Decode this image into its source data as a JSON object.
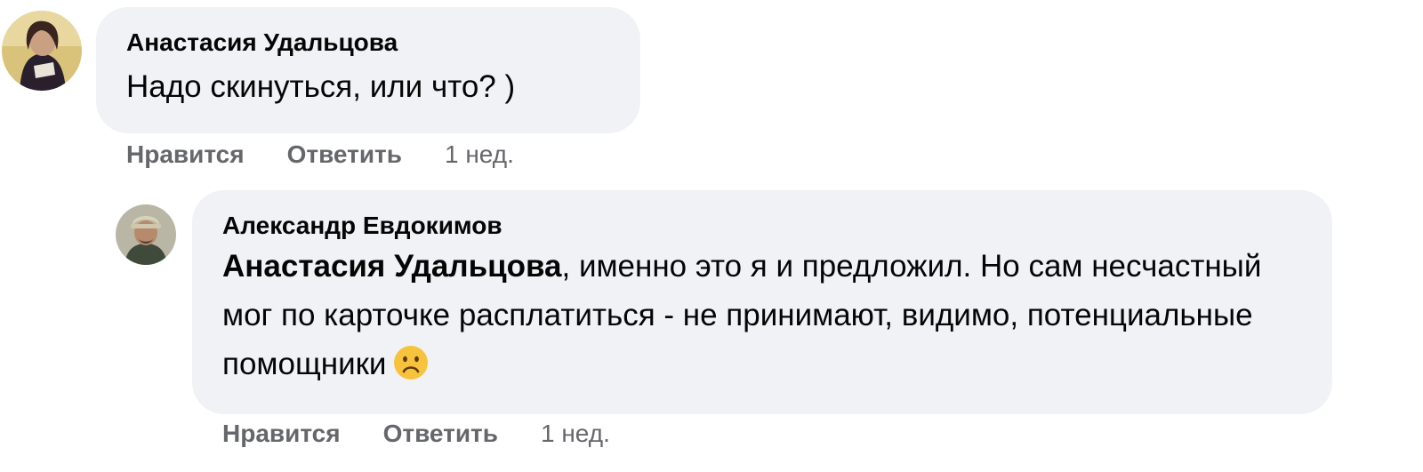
{
  "comments": [
    {
      "author": "Анастасия Удальцова",
      "text": "Надо скинуться, или что? )",
      "actions": {
        "like": "Нравится",
        "reply": "Ответить",
        "time": "1 нед."
      }
    },
    {
      "author": "Александр Евдокимов",
      "mention": "Анастасия Удальцова",
      "text": ", именно это я и предложил. Но сам несчастный мог по карточке расплатиться - не принимают, видимо, потенциальные помощники",
      "emoji": "sad-face-emoji",
      "actions": {
        "like": "Нравится",
        "reply": "Ответить",
        "time": "1 нед."
      }
    }
  ],
  "colors": {
    "bubble": "#f0f2f5",
    "text": "#050505",
    "meta": "#65676b",
    "emoji": "#f7c33c"
  }
}
